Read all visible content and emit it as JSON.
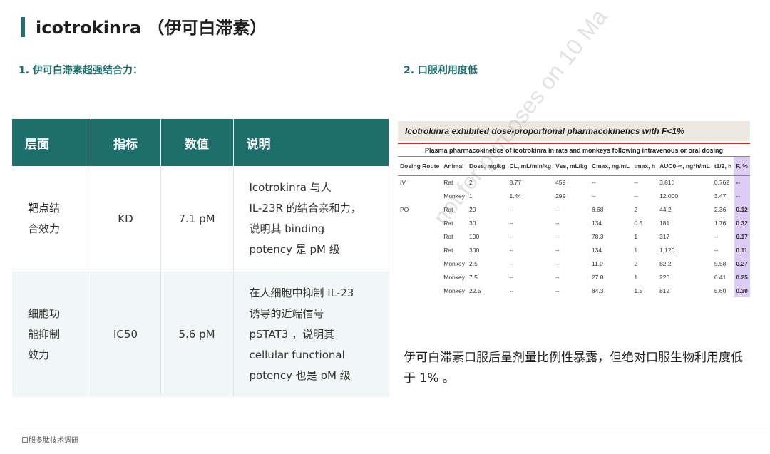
{
  "title": "icotrokinra （伊可白滞素）",
  "section1": "1.  伊可白滞素超强结合力：",
  "section2": "2.  口服利用度低",
  "table": {
    "headers": [
      "层面",
      "指标",
      "数值",
      "说明"
    ],
    "rows": [
      {
        "level": "靶点结\n合效力",
        "metric": "KD",
        "value": "7.1 pM",
        "desc": "Icotrokinra 与人\nIL-23R 的结合亲和力，\n说明其 binding\npotency 是 pM 级"
      },
      {
        "level": "细胞功\n能抑制\n效力",
        "metric": "IC50",
        "value": "5.6 pM",
        "desc": "在人细胞中抑制 IL-23\n诱导的近端信号\npSTAT3 ，说明其\ncellular functional\npotency 也是 pM 级"
      }
    ]
  },
  "pk_figure": {
    "heading": "Icotrokinra exhibited dose-proportional pharmacokinetics with F<1%",
    "subheading": "Plasma pharmacokinetics of icotrokinra in rats and monkeys following intravenous or oral dosing",
    "columns": [
      "Dosing Route",
      "Animal",
      "Dose, mg/kg",
      "CL, mL/min/kg",
      "Vss, mL/kg",
      "Cmax, ng/mL",
      "tmax, h",
      "AUC0-∞, ng*h/mL",
      "t1/2, h",
      "F, %"
    ],
    "rows": [
      [
        "IV",
        "Rat",
        "2",
        "8.77",
        "459",
        "--",
        "--",
        "3,810",
        "0.762",
        "--"
      ],
      [
        "",
        "Monkey",
        "1",
        "1.44",
        "299",
        "--",
        "--",
        "12,000",
        "3.47",
        "--"
      ],
      [
        "PO",
        "Rat",
        "20",
        "--",
        "--",
        "8.68",
        "2",
        "44.2",
        "2.36",
        "0.12"
      ],
      [
        "",
        "Rat",
        "30",
        "--",
        "--",
        "134",
        "0.5",
        "181",
        "1.76",
        "0.32"
      ],
      [
        "",
        "Rat",
        "100",
        "--",
        "--",
        "78.3",
        "1",
        "317",
        "--",
        "0.17"
      ],
      [
        "",
        "Rat",
        "300",
        "--",
        "--",
        "134",
        "1",
        "1,120",
        "--",
        "0.11"
      ],
      [
        "",
        "Monkey",
        "2.5",
        "--",
        "--",
        "11.0",
        "2",
        "82.2",
        "5.58",
        "0.27"
      ],
      [
        "",
        "Monkey",
        "7.5",
        "--",
        "--",
        "27.8",
        "1",
        "226",
        "6.41",
        "0.25"
      ],
      [
        "",
        "Monkey",
        "22.5",
        "--",
        "--",
        "84.3",
        "1.5",
        "812",
        "5.60",
        "0.30"
      ]
    ],
    "watermark": "not for purposes on 10 Ma"
  },
  "summary": "伊可白滞素口服后呈剂量比例性暴露，但绝对口服生物利用度低于 1% 。",
  "footer": "口服多肽技术调研"
}
